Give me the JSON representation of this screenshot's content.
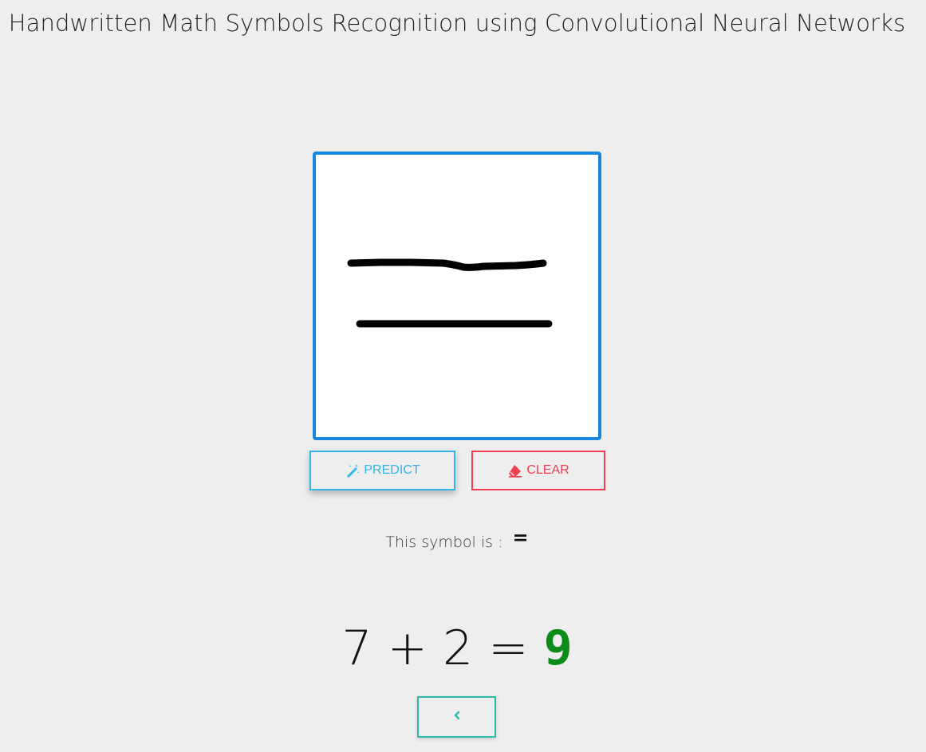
{
  "header": {
    "title": "Handwritten Math Symbols Recognition using Convolutional Neural Networks"
  },
  "canvas": {
    "border_color": "#1787e0",
    "stroke_color": "#000000"
  },
  "buttons": {
    "predict_label": "PREDICT",
    "predict_icon": "magic-wand-icon",
    "predict_color": "#33b5e5",
    "clear_label": "CLEAR",
    "clear_icon": "eraser-icon",
    "clear_color": "#f23d4f",
    "back_icon": "chevron-left-icon",
    "back_color": "#2bbbad"
  },
  "result": {
    "label": "This symbol is :",
    "symbol": "="
  },
  "equation": {
    "left_operand": "7",
    "operator": "+",
    "right_operand": "2",
    "equals": "=",
    "answer": "9",
    "answer_color": "#0c8a1a"
  }
}
